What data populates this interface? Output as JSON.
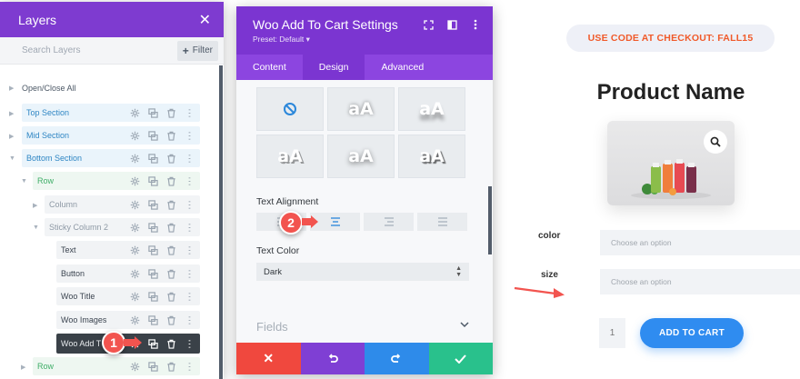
{
  "layers": {
    "title": "Layers",
    "search_placeholder": "Search Layers",
    "filter_label": "Filter",
    "toggle_all": "Open/Close All",
    "items": [
      {
        "label": "Top Section"
      },
      {
        "label": "Mid Section"
      },
      {
        "label": "Bottom Section"
      },
      {
        "label": "Row"
      },
      {
        "label": "Column"
      },
      {
        "label": "Sticky Column 2"
      },
      {
        "label": "Text"
      },
      {
        "label": "Button"
      },
      {
        "label": "Woo Title"
      },
      {
        "label": "Woo Images"
      },
      {
        "label": "Woo Add T"
      },
      {
        "label": "Row"
      }
    ]
  },
  "annotations": {
    "badge1": "1",
    "badge2": "2"
  },
  "settings": {
    "title": "Woo Add To Cart Settings",
    "preset": "Preset: Default ▾",
    "tabs": [
      "Content",
      "Design",
      "Advanced"
    ],
    "active_tab": "Design",
    "shadow_preview": "aA",
    "text_alignment_label": "Text Alignment",
    "selected_alignment": "center",
    "text_color_label": "Text Color",
    "text_color_value": "Dark",
    "fields_label": "Fields",
    "footer_colors": [
      "#f0483e",
      "#7f3fd4",
      "#2e8bea",
      "#29c18c"
    ]
  },
  "product": {
    "promo": "USE CODE AT CHECKOUT: FALL15",
    "name": "Product Name",
    "attr_color": "color",
    "attr_size": "size",
    "option_placeholder": "Choose an option",
    "quantity": "1",
    "add_to_cart": "ADD TO CART"
  },
  "colors": {
    "layers_header": "#7e3bd0",
    "settings_header": "#7b35d1",
    "promo_text": "#f05a2a",
    "cart_button": "#2f8cf0",
    "badge": "#f2544f"
  }
}
